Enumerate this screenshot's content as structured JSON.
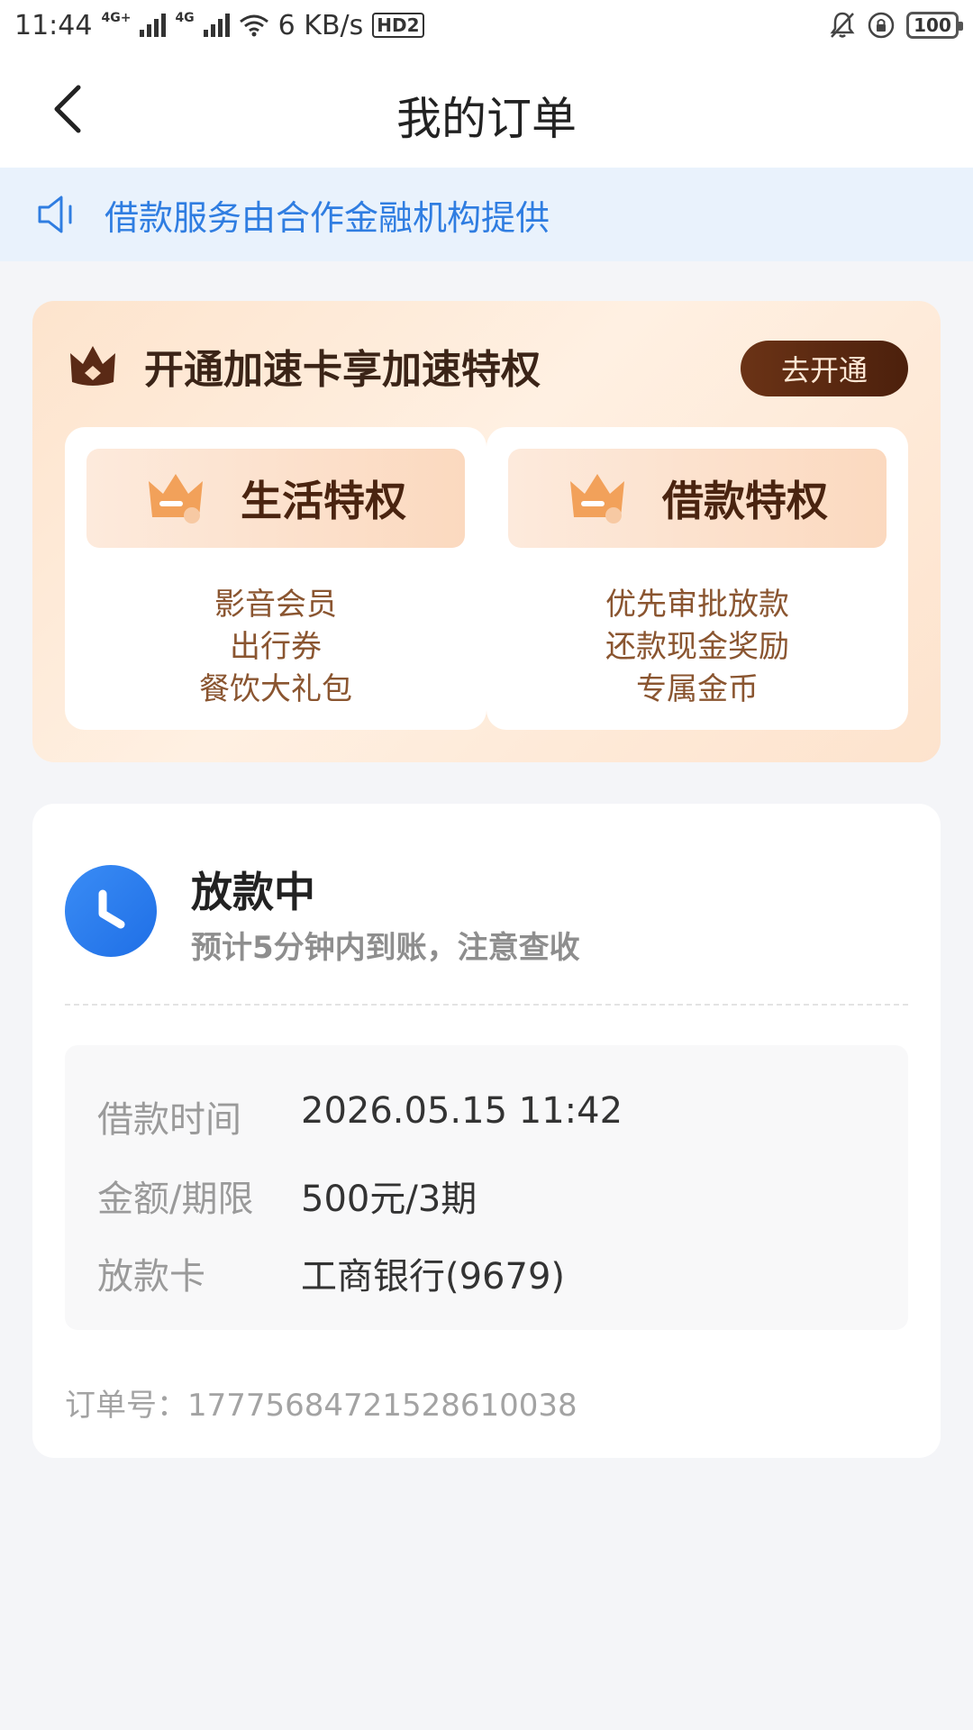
{
  "status_bar": {
    "time": "11:44",
    "net1": "4G+",
    "net2": "4G",
    "speed": "6 KB/s",
    "hd": "HD2",
    "battery": "100"
  },
  "header": {
    "title": "我的订单"
  },
  "notice": {
    "text": "借款服务由合作金融机构提供"
  },
  "promo": {
    "title": "开通加速卡享加速特权",
    "button": "去开通",
    "perks": [
      {
        "title": "生活特权",
        "items": [
          "影音会员",
          "出行券",
          "餐饮大礼包"
        ]
      },
      {
        "title": "借款特权",
        "items": [
          "优先审批放款",
          "还款现金奖励",
          "专属金币"
        ]
      }
    ]
  },
  "order": {
    "status": "放款中",
    "subtitle": "预计5分钟内到账，注意查收",
    "rows": [
      {
        "label": "借款时间",
        "value": "2026.05.15 11:42"
      },
      {
        "label": "金额/期限",
        "value": "500元/3期"
      },
      {
        "label": "放款卡",
        "value": "工商银行(9679)"
      }
    ],
    "order_no": "订单号：177756847215286100​38"
  },
  "colors": {
    "accent_blue": "#2f7de1",
    "promo_brown": "#4c200c",
    "perk_text": "#8a5530"
  }
}
